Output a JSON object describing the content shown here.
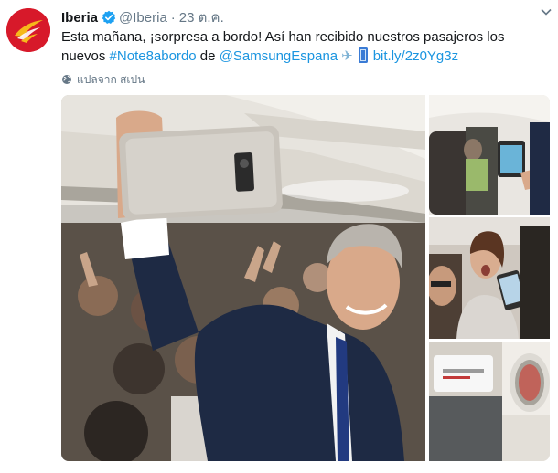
{
  "tweet": {
    "author_name": "Iberia",
    "handle": "@Iberia",
    "separator": "·",
    "timestamp": "23 ต.ค.",
    "text_part1": "Esta mañana, ¡sorpresa a bordo! Así han recibido nuestros pasajeros los nuevos ",
    "hashtag": "#Note8abordo",
    "text_part2": " de ",
    "mention": "@SamsungEspana",
    "link": "bit.ly/2z0Yg3z",
    "translate_label": "แปลจาก สเปน"
  },
  "icons": {
    "avatar": "iberia-logo",
    "verified": "verified-badge-icon",
    "caret": "chevron-down-icon",
    "translate": "globe-icon",
    "emoji1": "airplane-emoji",
    "emoji2": "mobile-phone-emoji"
  },
  "colors": {
    "brand_red": "#d7192a",
    "link_blue": "#1b95e0",
    "muted_gray": "#657786"
  },
  "media": {
    "photo_count": 4
  }
}
